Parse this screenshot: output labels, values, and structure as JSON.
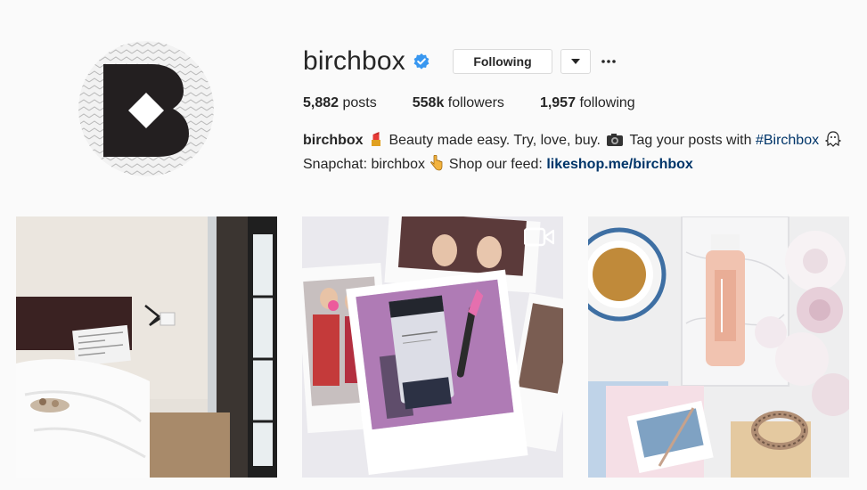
{
  "profile": {
    "username": "birchbox",
    "verified": true,
    "follow_label": "Following",
    "more_label": "•••"
  },
  "stats": {
    "posts_count": "5,882",
    "posts_label": "posts",
    "followers_count": "558k",
    "followers_label": "followers",
    "following_count": "1,957",
    "following_label": "following"
  },
  "bio": {
    "name": "birchbox",
    "line1_text": "Beauty made easy. Try, love, buy.",
    "line1_tag_prefix": "Tag your posts with",
    "hashtag": "#Birchbox",
    "line2_text": "Snapchat: birchbox",
    "shop_text": "Shop our feed:",
    "link": "likeshop.me/birchbox"
  },
  "posts": [
    {
      "kind": "photo"
    },
    {
      "kind": "video"
    },
    {
      "kind": "photo"
    }
  ],
  "colors": {
    "link": "#003569",
    "verified_badge": "#3897f0",
    "logo_dark": "#231f20"
  }
}
